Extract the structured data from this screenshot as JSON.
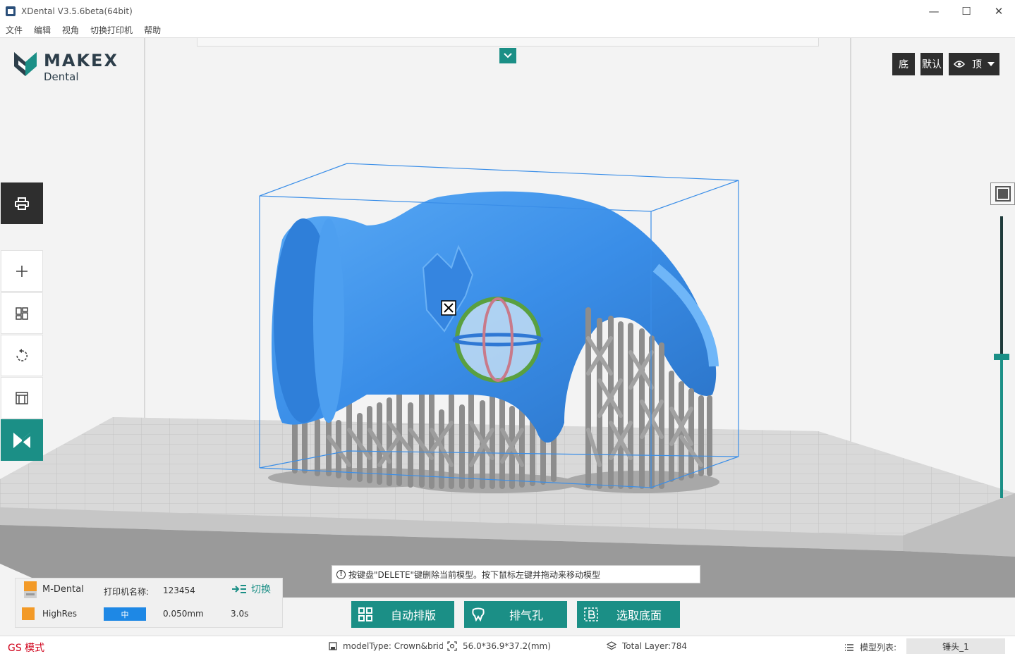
{
  "window": {
    "title": "XDental V3.5.6beta(64bit)"
  },
  "menu": [
    "文件",
    "编辑",
    "视角",
    "切换打印机",
    "帮助"
  ],
  "logo": {
    "word": "MAKEX",
    "sub": "Dental"
  },
  "toolbar": [
    "printer-icon",
    "plus-icon",
    "layout-icon",
    "rotate-icon",
    "support-icon",
    "makex-icon"
  ],
  "view_buttons": {
    "bottom": "底",
    "default": "默认",
    "top": "顶"
  },
  "hint": "按键盘\"DELETE\"键删除当前模型。按下鼠标左键并拖动来移动模型",
  "actions": {
    "auto_layout": "自动排版",
    "vent": "排气孔",
    "select_base": "选取底面"
  },
  "printer": {
    "brand": "M-Dental",
    "name_label": "打印机名称:",
    "name_value": "123454",
    "switch": "切换",
    "mode": "HighRes",
    "level": "中",
    "layer": "0.050mm",
    "time": "3.0s"
  },
  "status": {
    "gs_mode": "GS 模式",
    "model_type": "modelType: Crown&bridge",
    "dimensions": "56.0*36.9*37.2(mm)",
    "total_layer": "Total Layer:784",
    "model_list_label": "模型列表:",
    "model_selected": "锤头_1"
  },
  "slider": {
    "position_fraction": 0.5
  },
  "colors": {
    "accent": "#1b8f86",
    "model": "#3a8ee8",
    "support": "#9a9a9a",
    "bbox": "#3a8ee8"
  }
}
